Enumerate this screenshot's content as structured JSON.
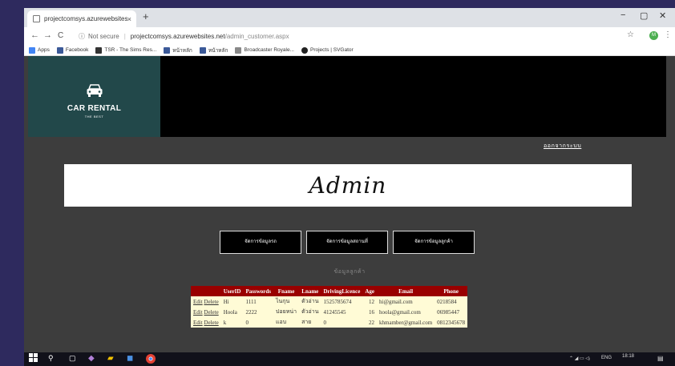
{
  "browser": {
    "tab_title": "projectcomsys.azurewebsites.ne",
    "tab_close": "×",
    "new_tab": "+",
    "win_min": "−",
    "win_max": "▢",
    "win_close": "✕",
    "back": "←",
    "forward": "→",
    "reload": "C",
    "security_icon": "ⓘ",
    "security": "Not secure",
    "url_host": "projectcomsys.azurewebsites.net",
    "url_path": "/admin_customer.aspx",
    "star": "☆",
    "avatar_letter": "M",
    "menu": "⋮"
  },
  "bookmarks": [
    {
      "label": "Apps",
      "color": "#4285f4"
    },
    {
      "label": "Facebook",
      "color": "#3b5998"
    },
    {
      "label": "TSR - The Sims Res...",
      "color": "#333333"
    },
    {
      "label": "หน้าหลัก",
      "color": "#3b5998"
    },
    {
      "label": "หน้าหลัก",
      "color": "#3b5998"
    },
    {
      "label": "Broadcaster Royale...",
      "color": "#888888"
    },
    {
      "label": "Projects | SVGator",
      "color": "#222222"
    }
  ],
  "site": {
    "brand": "CAR RENTAL",
    "tagline": "THE BEST",
    "logout": "ออกจากระบบ",
    "banner_title": "Admin",
    "menu": [
      "จัดการข้อมูลรถ",
      "จัดการข้อมูลสถานที่",
      "จัดการข้อมูลลูกค้า"
    ],
    "section_title": "ข้อมูลลูกค้า"
  },
  "table": {
    "headers": [
      "",
      "UserID",
      "Passwords",
      "Fname",
      "Lname",
      "DrivingLicence",
      "Age",
      "Email",
      "Phone"
    ],
    "edit": "Edit",
    "delete": "Delete",
    "rows": [
      [
        "Hi",
        "1111",
        "ไนกุน",
        "ตัวอ่าน",
        "1525785674",
        "12",
        "hi@gmail.com",
        "0218584"
      ],
      [
        "Hoola",
        "2222",
        "ปอยหน่า",
        "ตัวอ่าน",
        "41245545",
        "16",
        "hoola@gmail.com",
        "06985447"
      ],
      [
        "k",
        "0",
        "แอบ",
        "สาย",
        "0",
        "22",
        "khmamber@gmail.com",
        "0812345678"
      ]
    ]
  },
  "taskbar": {
    "lang": "ENG",
    "time": "18:18"
  }
}
